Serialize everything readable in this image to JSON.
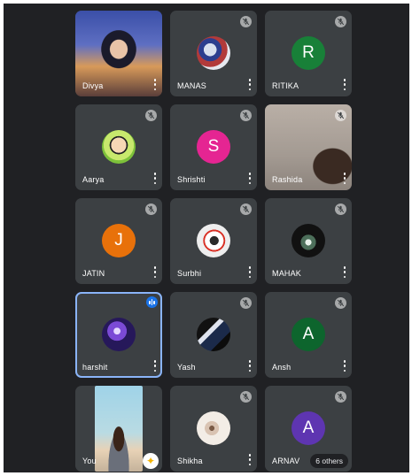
{
  "participants": [
    {
      "name": "Divya",
      "type": "video",
      "muted": false
    },
    {
      "name": "MANAS",
      "type": "avatar-image",
      "muted": true
    },
    {
      "name": "RITIKA",
      "type": "letter",
      "initial": "R",
      "color": "#188038",
      "muted": true
    },
    {
      "name": "Aarya",
      "type": "avatar-image",
      "muted": true
    },
    {
      "name": "Shrishti",
      "type": "letter",
      "initial": "S",
      "color": "#e52592",
      "muted": true
    },
    {
      "name": "Rashida",
      "type": "video",
      "muted": true
    },
    {
      "name": "JATIN",
      "type": "letter",
      "initial": "J",
      "color": "#e8710a",
      "muted": true
    },
    {
      "name": "Surbhi",
      "type": "avatar-image",
      "muted": true
    },
    {
      "name": "MAHAK",
      "type": "avatar-image",
      "muted": true
    },
    {
      "name": "harshit",
      "type": "avatar-image",
      "muted": false,
      "speaking": true
    },
    {
      "name": "Yash",
      "type": "avatar-image",
      "muted": true
    },
    {
      "name": "Ansh",
      "type": "letter",
      "initial": "A",
      "color": "#0d652d",
      "muted": true
    },
    {
      "name": "You",
      "type": "video",
      "muted": false
    },
    {
      "name": "Shikha",
      "type": "avatar-image",
      "muted": true
    },
    {
      "name": "ARNAV",
      "type": "letter",
      "initial": "A",
      "color": "#5e35b1",
      "muted": true
    }
  ],
  "overflow_label": "6 others",
  "colors": {
    "background": "#202124",
    "tile": "#3c4043",
    "active_border": "#8ab4f8",
    "speaking_badge": "#1a73e8"
  }
}
